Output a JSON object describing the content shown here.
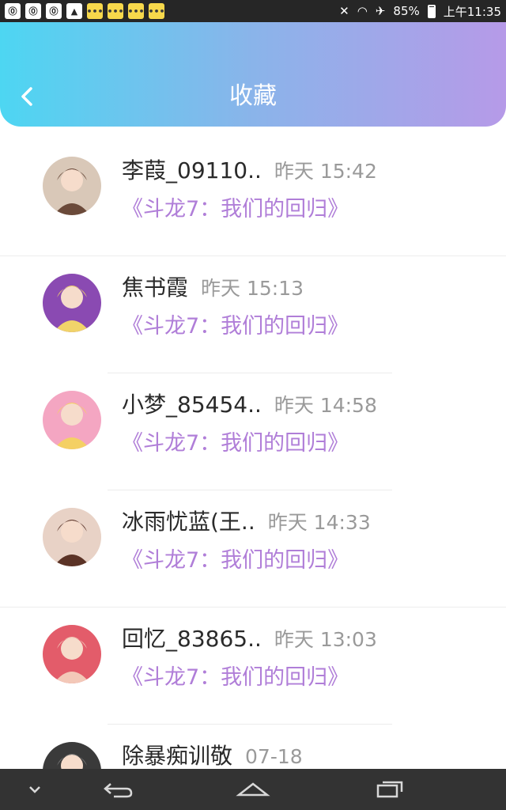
{
  "status_bar": {
    "left_icons": [
      {
        "name": "notification-icon",
        "glyph": "⓪",
        "kind": "plain"
      },
      {
        "name": "notification-icon",
        "glyph": "⓪",
        "kind": "plain"
      },
      {
        "name": "notification-icon",
        "glyph": "⓪",
        "kind": "plain"
      },
      {
        "name": "image-icon",
        "glyph": "▲",
        "kind": "plain"
      },
      {
        "name": "chat-icon",
        "glyph": "•••",
        "kind": "chat"
      },
      {
        "name": "chat-icon",
        "glyph": "•••",
        "kind": "chat"
      },
      {
        "name": "chat-icon",
        "glyph": "•••",
        "kind": "chat"
      },
      {
        "name": "chat-icon",
        "glyph": "•••",
        "kind": "chat"
      }
    ],
    "battery": "85%",
    "time": "上午11:35"
  },
  "header": {
    "title": "收藏"
  },
  "items": [
    {
      "name": "李葭_09110..",
      "time": "昨天 15:42",
      "book": "《斗龙7：我们的回归》",
      "avatar_color": "#6b4a3a",
      "avatar_bg": "#d9c8b8",
      "divider": "full"
    },
    {
      "name": "焦书霞",
      "time": "昨天 15:13",
      "book": "《斗龙7：我们的回归》",
      "avatar_color": "#f1d36a",
      "avatar_bg": "#8a4ab2",
      "divider": "short"
    },
    {
      "name": "小梦_85454..",
      "time": "昨天 14:58",
      "book": "《斗龙7：我们的回归》",
      "avatar_color": "#f4d064",
      "avatar_bg": "#f4a6c2",
      "divider": "short"
    },
    {
      "name": "冰雨忧蓝(王..",
      "time": "昨天 14:33",
      "book": "《斗龙7：我们的回归》",
      "avatar_color": "#5b3326",
      "avatar_bg": "#e8d2c6",
      "divider": "full"
    },
    {
      "name": "回忆_83865..",
      "time": "昨天 13:03",
      "book": "《斗龙7：我们的回归》",
      "avatar_color": "#f3c8b8",
      "avatar_bg": "#e35c6a",
      "divider": "short"
    },
    {
      "name": "除暴痴训敬",
      "time": "07-18",
      "book": "",
      "avatar_color": "#777777",
      "avatar_bg": "#3a3a3a",
      "divider": "none"
    }
  ]
}
